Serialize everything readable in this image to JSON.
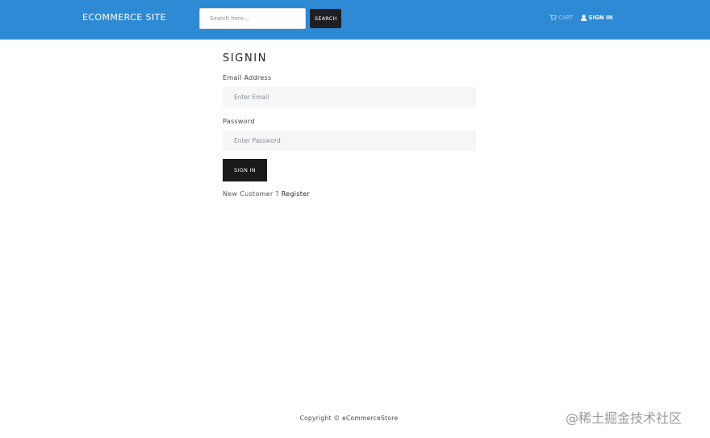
{
  "header": {
    "brand": "ECOMMERCE SITE",
    "search": {
      "placeholder": "Search here...",
      "button_label": "SEARCH"
    },
    "nav": {
      "cart_label": "CART",
      "signin_label": "SIGN IN"
    },
    "colors": {
      "navbar_bg": "#2f8ad6",
      "button_dark": "#1e1f22"
    },
    "icons": {
      "cart": "cart-icon",
      "user": "user-icon"
    }
  },
  "main": {
    "title": "SIGNIN",
    "email": {
      "label": "Email Address",
      "placeholder": "Enter Email"
    },
    "password": {
      "label": "Password",
      "placeholder": "Enter Password"
    },
    "submit_label": "SIGN IN",
    "register": {
      "prompt": "New Customer ? ",
      "link_text": "Register"
    }
  },
  "footer": {
    "copyright": "Copyright © eCommerceStore"
  },
  "watermark": {
    "text": "@稀土掘金技术社区"
  }
}
